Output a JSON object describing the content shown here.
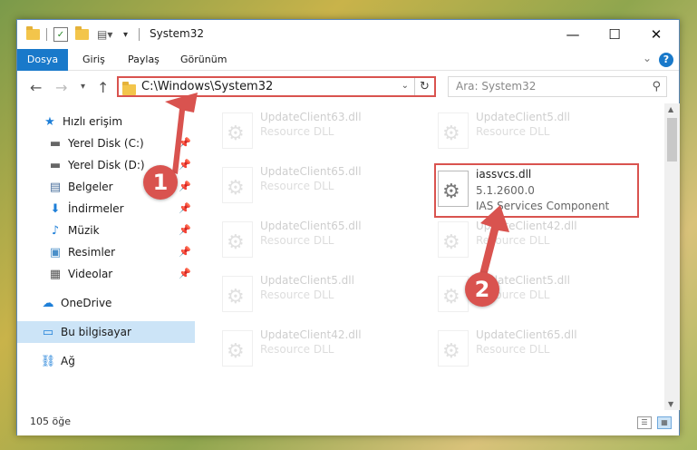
{
  "titlebar": {
    "title": "System32",
    "qa_dropdown": "▾",
    "minimize": "—",
    "maximize": "☐",
    "close": "✕"
  },
  "ribbon": {
    "tabs": [
      "Dosya",
      "Giriş",
      "Paylaş",
      "Görünüm"
    ],
    "help": "?",
    "collapse": "⌄"
  },
  "nav": {
    "back": "←",
    "forward": "→",
    "recent": "▾",
    "up": "↑",
    "address": "C:\\Windows\\System32",
    "address_dropdown": "⌄",
    "refresh": "↻",
    "search_placeholder": "Ara: System32",
    "search_icon": "⚲"
  },
  "sidebar": {
    "items": [
      {
        "label": "Hızlı erişim",
        "icon": "star-icon",
        "glyph": "★",
        "color": "#1e7fd8"
      },
      {
        "label": "Yerel Disk (C:)",
        "icon": "drive-icon",
        "glyph": "▬",
        "color": "#666"
      },
      {
        "label": "Yerel Disk (D:)",
        "icon": "drive-icon",
        "glyph": "▬",
        "color": "#666"
      },
      {
        "label": "Belgeler",
        "icon": "documents-icon",
        "glyph": "▤",
        "color": "#4a6f9c"
      },
      {
        "label": "İndirmeler",
        "icon": "downloads-icon",
        "glyph": "⬇",
        "color": "#1e7fd8"
      },
      {
        "label": "Müzik",
        "icon": "music-icon",
        "glyph": "♪",
        "color": "#1e7fd8"
      },
      {
        "label": "Resimler",
        "icon": "pictures-icon",
        "glyph": "▣",
        "color": "#4a8fc9"
      },
      {
        "label": "Videolar",
        "icon": "videos-icon",
        "glyph": "▦",
        "color": "#555"
      },
      {
        "label": "OneDrive",
        "icon": "cloud-icon",
        "glyph": "☁",
        "color": "#1e7fd8"
      },
      {
        "label": "Bu bilgisayar",
        "icon": "computer-icon",
        "glyph": "▭",
        "color": "#1e7fd8"
      },
      {
        "label": "Ağ",
        "icon": "network-icon",
        "glyph": "⛓",
        "color": "#1e7fd8"
      }
    ],
    "pin": "📌"
  },
  "files": {
    "left": [
      {
        "name": "UpdateClient63.dll",
        "sub": "Resource DLL"
      },
      {
        "name": "UpdateClient65.dll",
        "sub": "Resource DLL"
      },
      {
        "name": "UpdateClient65.dll",
        "sub": "Resource DLL"
      },
      {
        "name": "UpdateClient5.dll",
        "sub": "Resource DLL"
      },
      {
        "name": "UpdateClient42.dll",
        "sub": "Resource DLL"
      }
    ],
    "right_top": {
      "name": "UpdateClient5.dll",
      "sub": "Resource DLL"
    },
    "highlighted": {
      "name": "iassvcs.dll",
      "version": "5.1.2600.0",
      "description": "IAS Services Component"
    },
    "right": [
      {
        "name": "UpdateClient42.dll",
        "sub": "Resource DLL"
      },
      {
        "name": "UpdateClient5.dll",
        "sub": "Resource DLL"
      },
      {
        "name": "UpdateClient65.dll",
        "sub": "Resource DLL"
      }
    ],
    "gear": "⚙"
  },
  "status": {
    "count": "105 öğe",
    "details_view": "☰",
    "tiles_view": "▦"
  },
  "annotations": {
    "step1": "1",
    "step2": "2",
    "color": "#d9534f"
  }
}
